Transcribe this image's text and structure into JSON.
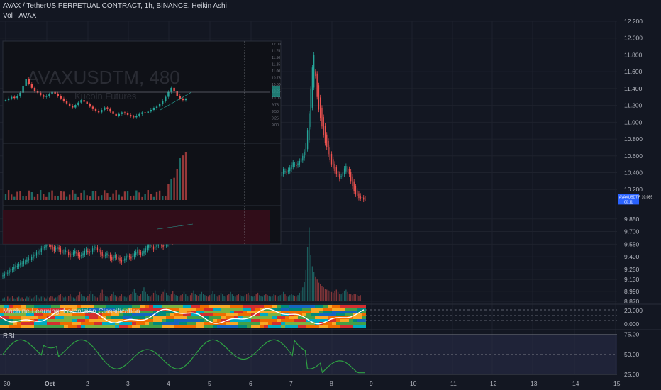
{
  "header": {
    "title": "AVAX / TetherUS PERPETUAL CONTRACT, 1h, BINANCE, Heikin Ashi",
    "subtitle": "Vol · AVAX"
  },
  "watermark": {
    "symbol": "AVAXUSDTM, 480",
    "exchange": "Kucoin Futures"
  },
  "price_tag": {
    "label": "AVAXUSDT.P",
    "price": "10.089",
    "countdown": "00:11"
  },
  "colors": {
    "background": "#131722",
    "up": "#26a69a",
    "down": "#ef5350",
    "rsi_line": "#2ea043",
    "rsi_band": "#2a2e4a",
    "ml_line": "#ffffff",
    "price_line": "#2962ff"
  },
  "panes": {
    "ml_label": "Machine Learning: Lorentzian Classification",
    "rsi_label": "RSI"
  },
  "chart_data": [
    {
      "type": "candlestick",
      "title": "AVAX / TetherUS PERPETUAL CONTRACT, 1h, BINANCE, Heikin Ashi",
      "x_ticks": [
        "30",
        "Oct",
        "2",
        "3",
        "4",
        "5",
        "6",
        "7",
        "8",
        "9",
        "10",
        "11",
        "12",
        "13",
        "14",
        "15"
      ],
      "y_ticks": [
        "12.200",
        "12.000",
        "11.800",
        "11.600",
        "11.400",
        "11.200",
        "11.000",
        "10.800",
        "10.600",
        "10.400",
        "10.200",
        "10.089",
        "9.850",
        "9.700",
        "9.550",
        "9.400",
        "9.250",
        "9.130",
        "8.990",
        "8.870"
      ],
      "ylim": [
        8.87,
        12.2
      ],
      "close": [
        9.18,
        9.2,
        9.22,
        9.21,
        9.24,
        9.26,
        9.25,
        9.28,
        9.3,
        9.29,
        9.31,
        9.33,
        9.32,
        9.35,
        9.34,
        9.37,
        9.39,
        9.36,
        9.4,
        9.43,
        9.42,
        9.45,
        9.47,
        9.46,
        9.5,
        9.53,
        9.51,
        9.55,
        9.57,
        9.54,
        9.52,
        9.49,
        9.47,
        9.5,
        9.52,
        9.49,
        9.46,
        9.44,
        9.46,
        9.48,
        9.45,
        9.42,
        9.4,
        9.43,
        9.45,
        9.47,
        9.44,
        9.41,
        9.39,
        9.42,
        9.44,
        9.47,
        9.49,
        9.46,
        9.44,
        9.47,
        9.5,
        9.53,
        9.51,
        9.48,
        9.46,
        9.43,
        9.41,
        9.39,
        9.42,
        9.44,
        9.41,
        9.38,
        9.36,
        9.39,
        9.42,
        9.4,
        9.37,
        9.35,
        9.33,
        9.36,
        9.38,
        9.41,
        9.43,
        9.4,
        9.38,
        9.41,
        9.44,
        9.46,
        9.48,
        9.45,
        9.42,
        9.44,
        9.47,
        9.5,
        9.53,
        9.56,
        9.54,
        9.51,
        9.49,
        9.52,
        9.55,
        9.58,
        9.56,
        9.53,
        9.51,
        9.54,
        9.57,
        9.6,
        9.62,
        9.59,
        9.57,
        9.6,
        9.63,
        9.66,
        9.64,
        9.62,
        9.6,
        9.63,
        9.66,
        9.69,
        9.72,
        9.7,
        9.68,
        9.71,
        9.74,
        9.72,
        9.7,
        9.73,
        9.76,
        9.79,
        9.82,
        9.8,
        9.78,
        9.76,
        9.79,
        9.82,
        9.85,
        9.88,
        9.86,
        9.84,
        9.87,
        9.9,
        9.93,
        9.96,
        9.94,
        9.92,
        9.95,
        9.98,
        10.01,
        10.04,
        10.02,
        10.0,
        10.03,
        10.06,
        10.09,
        10.12,
        10.1,
        10.08,
        10.11,
        10.14,
        10.17,
        10.2,
        10.18,
        10.16,
        10.19,
        10.22,
        10.25,
        10.28,
        10.26,
        10.24,
        10.27,
        10.3,
        10.33,
        10.36,
        10.34,
        10.32,
        10.35,
        10.38,
        10.41,
        10.44,
        10.42,
        10.4,
        10.43,
        10.46,
        10.49,
        10.52,
        10.5,
        10.48,
        10.51,
        10.54,
        10.57,
        10.6,
        10.65,
        10.75,
        10.9,
        11.1,
        11.4,
        11.65,
        11.8,
        11.55,
        11.3,
        11.15,
        11.05,
        10.95,
        10.85,
        10.75,
        10.7,
        10.62,
        10.55,
        10.5,
        10.45,
        10.42,
        10.38,
        10.35,
        10.33,
        10.36,
        10.4,
        10.45,
        10.48,
        10.44,
        10.38,
        10.3,
        10.24,
        10.18,
        10.14,
        10.12,
        10.1,
        10.09,
        10.1,
        10.08,
        10.09
      ],
      "volume": [
        0.04,
        0.05,
        0.03,
        0.06,
        0.04,
        0.05,
        0.07,
        0.04,
        0.03,
        0.05,
        0.06,
        0.04,
        0.05,
        0.03,
        0.04,
        0.06,
        0.05,
        0.07,
        0.04,
        0.05,
        0.06,
        0.08,
        0.05,
        0.04,
        0.06,
        0.07,
        0.05,
        0.04,
        0.06,
        0.05,
        0.07,
        0.06,
        0.04,
        0.05,
        0.06,
        0.08,
        0.1,
        0.07,
        0.05,
        0.06,
        0.05,
        0.07,
        0.09,
        0.06,
        0.05,
        0.04,
        0.06,
        0.08,
        0.12,
        0.09,
        0.07,
        0.06,
        0.05,
        0.07,
        0.1,
        0.13,
        0.09,
        0.07,
        0.06,
        0.05,
        0.08,
        0.11,
        0.15,
        0.1,
        0.07,
        0.06,
        0.05,
        0.07,
        0.09,
        0.12,
        0.08,
        0.06,
        0.05,
        0.07,
        0.09,
        0.07,
        0.06,
        0.05,
        0.06,
        0.08,
        0.1,
        0.12,
        0.16,
        0.11,
        0.08,
        0.07,
        0.09,
        0.13,
        0.18,
        0.12,
        0.09,
        0.07,
        0.06,
        0.08,
        0.11,
        0.14,
        0.1,
        0.08,
        0.07,
        0.09,
        0.12,
        0.15,
        0.11,
        0.08,
        0.07,
        0.09,
        0.13,
        0.1,
        0.08,
        0.07,
        0.06,
        0.08,
        0.1,
        0.12,
        0.09,
        0.07,
        0.06,
        0.08,
        0.11,
        0.14,
        0.1,
        0.08,
        0.07,
        0.09,
        0.12,
        0.1,
        0.08,
        0.07,
        0.06,
        0.08,
        0.1,
        0.13,
        0.09,
        0.07,
        0.06,
        0.08,
        0.11,
        0.09,
        0.07,
        0.06,
        0.08,
        0.1,
        0.12,
        0.09,
        0.07,
        0.06,
        0.08,
        0.1,
        0.08,
        0.07,
        0.06,
        0.08,
        0.09,
        0.11,
        0.08,
        0.07,
        0.06,
        0.07,
        0.09,
        0.11,
        0.08,
        0.07,
        0.06,
        0.08,
        0.1,
        0.08,
        0.07,
        0.06,
        0.07,
        0.09,
        0.08,
        0.06,
        0.07,
        0.08,
        0.1,
        0.12,
        0.09,
        0.07,
        0.06,
        0.08,
        0.1,
        0.08,
        0.07,
        0.06,
        0.08,
        0.11,
        0.14,
        0.18,
        0.25,
        0.4,
        0.7,
        0.95,
        0.6,
        0.45,
        0.38,
        0.32,
        0.28,
        0.24,
        0.22,
        0.2,
        0.18,
        0.16,
        0.15,
        0.14,
        0.13,
        0.12,
        0.11,
        0.13,
        0.15,
        0.12,
        0.1,
        0.09,
        0.11,
        0.13,
        0.15,
        0.12,
        0.1,
        0.09,
        0.08,
        0.1,
        0.09,
        0.08,
        0.07,
        0.08
      ],
      "rsi_ticks": [
        "75.00",
        "50.00",
        "25.00"
      ],
      "rsi_ylim": [
        25,
        80
      ],
      "ml_ticks": [
        "20.000",
        "0.000"
      ]
    },
    {
      "type": "candlestick",
      "title": "AVAXUSDTM, 480",
      "y_ticks": [
        "12.00",
        "11.75",
        "11.50",
        "11.25",
        "11.00",
        "10.75",
        "10.50",
        "10.25",
        "10.00",
        "9.75",
        "9.50",
        "9.25",
        "9.00"
      ],
      "close": [
        9.1,
        9.14,
        9.18,
        9.15,
        9.2,
        9.28,
        9.45,
        9.62,
        9.5,
        9.4,
        9.32,
        9.28,
        9.22,
        9.18,
        9.2,
        9.24,
        9.3,
        9.26,
        9.2,
        9.14,
        9.08,
        9.02,
        8.96,
        8.92,
        8.98,
        9.04,
        9.1,
        9.06,
        9.0,
        8.94,
        8.88,
        8.84,
        8.8,
        8.86,
        8.92,
        8.88,
        8.82,
        8.76,
        8.72,
        8.76,
        8.8,
        8.78,
        8.74,
        8.7,
        8.68,
        8.72,
        8.76,
        8.8,
        8.78,
        8.82,
        8.86,
        8.9,
        8.94,
        9.0,
        9.08,
        9.18,
        9.3,
        9.4,
        9.32,
        9.2,
        9.14,
        9.1,
        9.12
      ]
    }
  ]
}
